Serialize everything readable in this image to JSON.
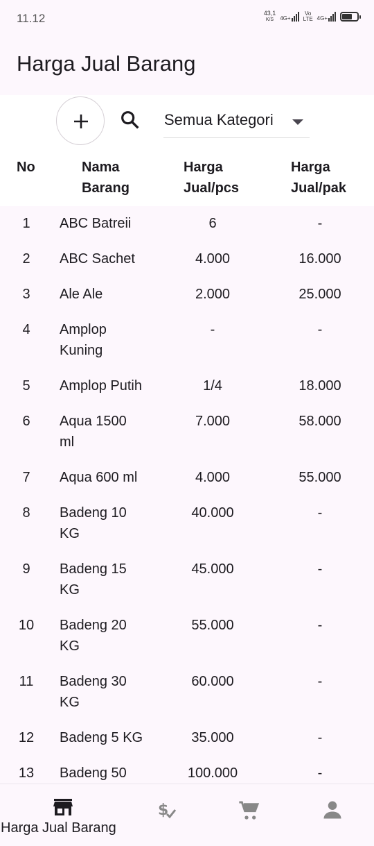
{
  "status": {
    "time": "11.12",
    "speed_value": "43,1",
    "speed_unit": "K/S",
    "net1": "4G+",
    "net2_top": "Vo",
    "net2_bottom": "LTE",
    "net3": "4G+"
  },
  "app": {
    "title": "Harga Jual Barang"
  },
  "toolbar": {
    "category_selected": "Semua Kategori"
  },
  "table": {
    "headers": {
      "no": "No",
      "name_line1": "Nama",
      "name_line2": "Barang",
      "pcs_line1": "Harga",
      "pcs_line2": "Jual/pcs",
      "pak_line1": "Harga",
      "pak_line2": "Jual/pak"
    },
    "rows": [
      {
        "no": "1",
        "name1": "ABC Batreii",
        "name2": "",
        "pcs": "6",
        "pak": "-"
      },
      {
        "no": "2",
        "name1": "ABC Sachet",
        "name2": "",
        "pcs": "4.000",
        "pak": "16.000"
      },
      {
        "no": "3",
        "name1": "Ale Ale",
        "name2": "",
        "pcs": "2.000",
        "pak": "25.000"
      },
      {
        "no": "4",
        "name1": "Amplop",
        "name2": "Kuning",
        "pcs": "-",
        "pak": "-"
      },
      {
        "no": "5",
        "name1": "Amplop Putih",
        "name2": "",
        "pcs": "1/4",
        "pak": "18.000"
      },
      {
        "no": "6",
        "name1": "Aqua 1500",
        "name2": "ml",
        "pcs": "7.000",
        "pak": "58.000"
      },
      {
        "no": "7",
        "name1": "Aqua 600 ml",
        "name2": "",
        "pcs": "4.000",
        "pak": "55.000"
      },
      {
        "no": "8",
        "name1": "Badeng 10",
        "name2": "KG",
        "pcs": "40.000",
        "pak": "-"
      },
      {
        "no": "9",
        "name1": "Badeng 15",
        "name2": "KG",
        "pcs": "45.000",
        "pak": "-"
      },
      {
        "no": "10",
        "name1": "Badeng 20",
        "name2": "KG",
        "pcs": "55.000",
        "pak": "-"
      },
      {
        "no": "11",
        "name1": "Badeng 30",
        "name2": "KG",
        "pcs": "60.000",
        "pak": "-"
      },
      {
        "no": "12",
        "name1": "Badeng 5 KG",
        "name2": "",
        "pcs": "35.000",
        "pak": "-"
      },
      {
        "no": "13",
        "name1": "Badeng 50",
        "name2": "",
        "pcs": "100.000",
        "pak": "-"
      }
    ]
  },
  "nav": {
    "active_label": "Harga Jual Barang"
  },
  "colors": {
    "background": "#fdf7fd",
    "surface": "#ffffff",
    "text": "#1d1b20",
    "inactive_icon": "#888888"
  },
  "icons": [
    "plus-icon",
    "search-icon",
    "caret-down-icon",
    "store-icon",
    "price-check-icon",
    "cart-icon",
    "person-icon"
  ]
}
